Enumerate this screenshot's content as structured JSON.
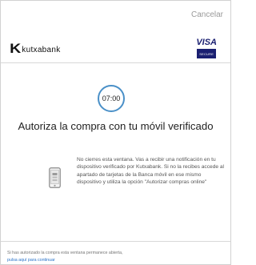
{
  "header": {
    "cancel_label": "Cancelar",
    "bank_name": "kutxabank",
    "bank_initial": "K",
    "card_brand": "VISA",
    "card_badge": "SECURE"
  },
  "timer": {
    "value": "07:00"
  },
  "main": {
    "title": "Autoriza la compra con tu móvil verificado",
    "description": "No cierres esta ventana. Vas a recibir una notificación en tu dispositivo verificado por Kutxabank. Si no la recibes accede al apartado de tarjetas de la Banca móvil en ese mismo dispositivo y utiliza la opción \"Autorizar compras online\""
  },
  "footer": {
    "text": "Si has autorizado la compra esta ventana permanece abierta,",
    "link_label": "pulsa aquí para continuar"
  },
  "colors": {
    "timer_ring": "#4a90c8",
    "visa_blue": "#1a1f71",
    "link": "#2a73c9"
  },
  "icons": {
    "device": "smartphone-icon"
  }
}
